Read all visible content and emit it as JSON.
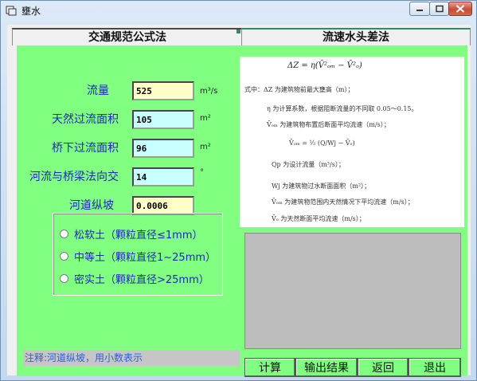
{
  "window": {
    "title": "壅水"
  },
  "tabs": [
    {
      "label": "交通规范公式法"
    },
    {
      "label": "流速水头差法"
    }
  ],
  "fields": [
    {
      "label": "流量",
      "value": "525",
      "unit": "m³/s",
      "color": "#ffffc8"
    },
    {
      "label": "天然过流面积",
      "value": "105",
      "unit": "m²",
      "color": "#c8ffff"
    },
    {
      "label": "桥下过流面积",
      "value": "96",
      "unit": "m²",
      "color": "#c8ffff"
    },
    {
      "label": "河流与桥梁法向交",
      "value": "14",
      "unit": "°",
      "color": "#c8ffff"
    },
    {
      "label": "河道纵坡",
      "value": "0.0006",
      "unit": "",
      "color": "#ffffc8"
    }
  ],
  "soil_options": [
    {
      "label": "松软土（颗粒直径≤1mm）"
    },
    {
      "label": "中等土（颗粒直径1~25mm）"
    },
    {
      "label": "密实土（颗粒直径>25mm）"
    }
  ],
  "note": "注释:河道纵坡，用小数表示",
  "formula": {
    "main": "ΔZ = η(V̄²ₒₘ − V̄²ₒ)",
    "lines": [
      "式中：ΔZ 为建筑物前最大壅高（m）；",
      "η 为计算系数，根据阻断流量的不同取 0.05～0.15。",
      "V̄ₒₘ 为建筑物布置后断面平均流速（m/s）；",
      "V̄ₒₘ = ½ (Q/Wj − V̄ₒ)",
      "Qp  为设计流量（m³/s）；",
      "Wj  为建筑物过水断面面积（m²）；",
      "V̄ₒₘ  为建筑物范围内天然情况下平均流速（m/s）；",
      "V̄ₒ  为天然断面平均流速（m/s）；"
    ]
  },
  "actions": [
    {
      "label": "计算"
    },
    {
      "label": "输出结果"
    },
    {
      "label": "返回"
    },
    {
      "label": "退出"
    }
  ],
  "colors": {
    "panel": "#80ff80",
    "label_text": "#1e28b4",
    "result_box": "#bdbdbd"
  }
}
